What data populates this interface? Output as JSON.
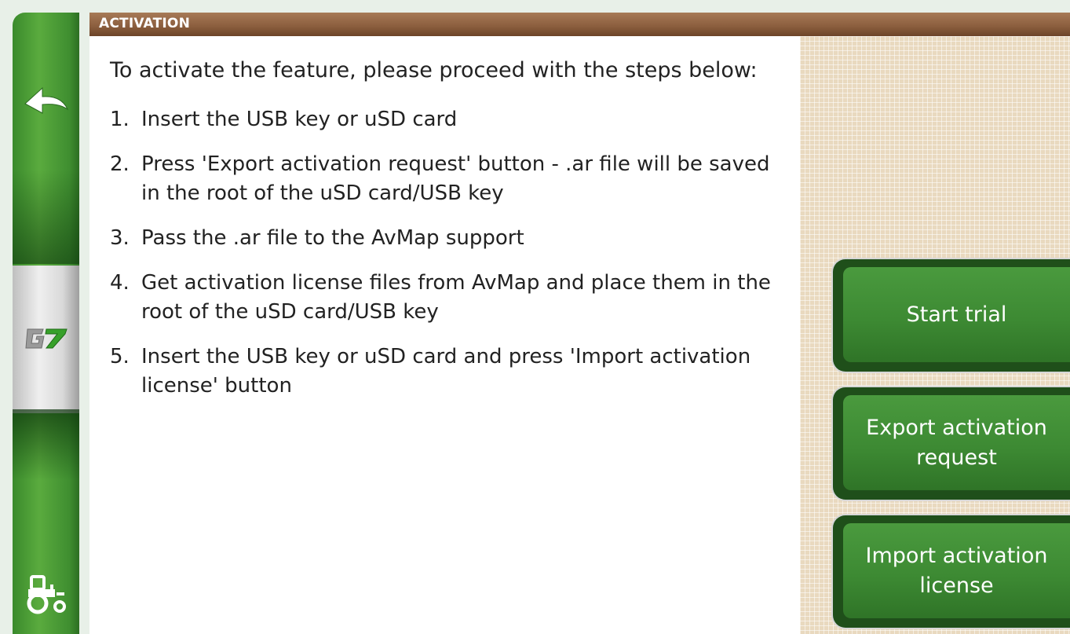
{
  "header": {
    "title": "ACTIVATION"
  },
  "sidebar": {
    "back_icon": "back-arrow-icon",
    "logo_icon": "g7-logo-icon",
    "tractor_icon": "tractor-icon",
    "logo_text": "G7"
  },
  "content": {
    "intro": "To activate the feature, please proceed with the steps below:",
    "steps": [
      {
        "num": "1.",
        "text": "Insert the USB key or uSD card"
      },
      {
        "num": "2.",
        "text": "Press 'Export activation request' button - .ar file will be saved in the root of the uSD card/USB key"
      },
      {
        "num": "3.",
        "text": "Pass the .ar file to the AvMap support"
      },
      {
        "num": "4.",
        "text": "Get activation license files from AvMap and place them in the root of the uSD card/USB key"
      },
      {
        "num": "5.",
        "text": "Insert the USB key or uSD card and press 'Import activation license' button"
      }
    ]
  },
  "buttons": {
    "start_trial": "Start trial",
    "export_request": "Export activation request",
    "import_license": "Import activation license"
  },
  "colors": {
    "header_brown": "#8a5d3d",
    "sidebar_green": "#3f8e30",
    "button_green": "#3d8a33",
    "panel_beige": "#e9d9bf"
  }
}
